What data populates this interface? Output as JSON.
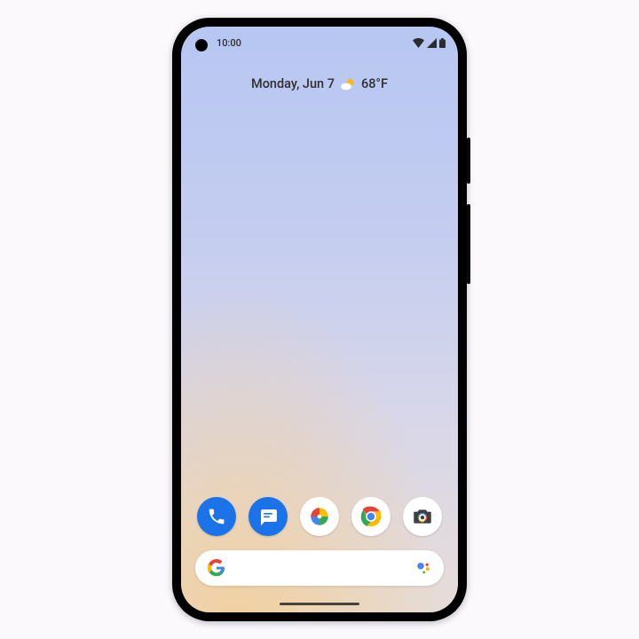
{
  "status": {
    "time": "10:00"
  },
  "glance": {
    "date": "Monday, Jun 7",
    "temp": "68°F"
  },
  "dock": {
    "apps": [
      "phone",
      "messages",
      "photos",
      "chrome",
      "camera"
    ]
  },
  "colors": {
    "blue": "#1a73e8",
    "red": "#ea4335",
    "yellow": "#fbbc05",
    "green": "#34a853"
  }
}
